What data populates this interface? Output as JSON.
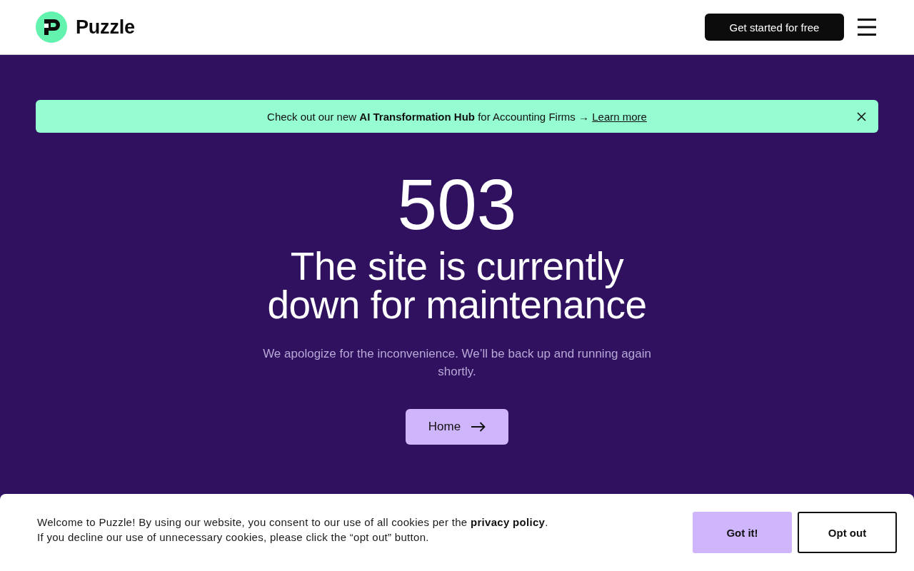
{
  "header": {
    "brand": "Puzzle",
    "cta": "Get started for free"
  },
  "announcement": {
    "text": "Check out our new **AI Transformation Hub** for Accounting Firms →",
    "link": "Learn more"
  },
  "error_page": {
    "code": "503",
    "title_lines": [
      "The site is currently",
      "down for maintenance"
    ],
    "message": "We apologize for the inconvenience. We’ll be back up and running again shortly.",
    "button": "Home"
  },
  "cookie_notice": {
    "text": "Welcome to Puzzle! By using our website, you consent to our use of all cookies per the",
    "link": "privacy policy",
    "text_end": ".",
    "second_line": "If you decline our use of unnecessary cookies, please click the “opt out” button.",
    "buttons": [
      {
        "label": "Got it!",
        "kind": "primary"
      },
      {
        "label": "Opt out",
        "kind": "outline"
      }
    ]
  }
}
